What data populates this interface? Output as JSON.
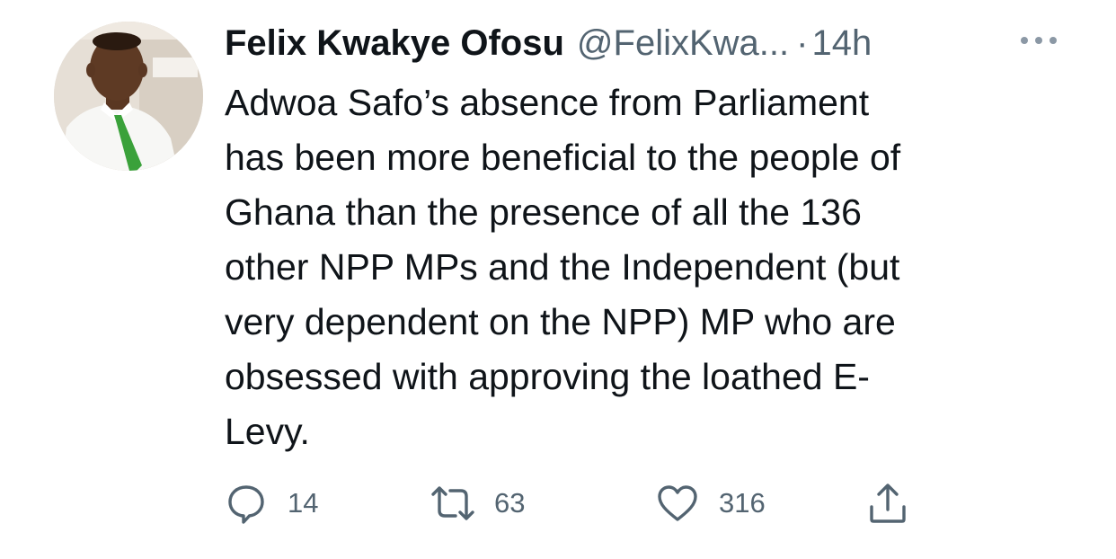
{
  "tweet": {
    "author": {
      "display_name": "Felix Kwakye Ofosu",
      "handle": "@FelixKwa...",
      "separator": "·",
      "time": "14h"
    },
    "text": "Adwoa Safo’s absence from Parliament\nhas been more beneficial to the people of\nGhana than the presence of all the 136\nother NPP MPs and the Independent (but\nvery dependent on the NPP) MP who are\nobsessed with approving the  loathed E-\nLevy.",
    "actions": {
      "reply": {
        "icon": "reply-icon",
        "count": "14"
      },
      "retweet": {
        "icon": "retweet-icon",
        "count": "63"
      },
      "like": {
        "icon": "heart-icon",
        "count": "316"
      },
      "share": {
        "icon": "share-icon"
      }
    },
    "more_icon": "more-dots-icon"
  },
  "colors": {
    "text_primary": "#0f1419",
    "text_secondary": "#536471",
    "background": "#ffffff",
    "tie_green": "#3aa13a"
  }
}
